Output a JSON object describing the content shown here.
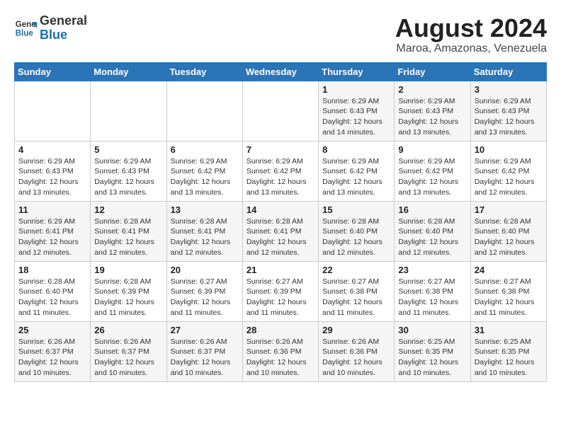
{
  "logo": {
    "general": "General",
    "blue": "Blue"
  },
  "title": "August 2024",
  "subtitle": "Maroa, Amazonas, Venezuela",
  "days_of_week": [
    "Sunday",
    "Monday",
    "Tuesday",
    "Wednesday",
    "Thursday",
    "Friday",
    "Saturday"
  ],
  "weeks": [
    [
      {
        "day": "",
        "info": ""
      },
      {
        "day": "",
        "info": ""
      },
      {
        "day": "",
        "info": ""
      },
      {
        "day": "",
        "info": ""
      },
      {
        "day": "1",
        "info": "Sunrise: 6:29 AM\nSunset: 6:43 PM\nDaylight: 12 hours\nand 14 minutes."
      },
      {
        "day": "2",
        "info": "Sunrise: 6:29 AM\nSunset: 6:43 PM\nDaylight: 12 hours\nand 13 minutes."
      },
      {
        "day": "3",
        "info": "Sunrise: 6:29 AM\nSunset: 6:43 PM\nDaylight: 12 hours\nand 13 minutes."
      }
    ],
    [
      {
        "day": "4",
        "info": "Sunrise: 6:29 AM\nSunset: 6:43 PM\nDaylight: 12 hours\nand 13 minutes."
      },
      {
        "day": "5",
        "info": "Sunrise: 6:29 AM\nSunset: 6:43 PM\nDaylight: 12 hours\nand 13 minutes."
      },
      {
        "day": "6",
        "info": "Sunrise: 6:29 AM\nSunset: 6:42 PM\nDaylight: 12 hours\nand 13 minutes."
      },
      {
        "day": "7",
        "info": "Sunrise: 6:29 AM\nSunset: 6:42 PM\nDaylight: 12 hours\nand 13 minutes."
      },
      {
        "day": "8",
        "info": "Sunrise: 6:29 AM\nSunset: 6:42 PM\nDaylight: 12 hours\nand 13 minutes."
      },
      {
        "day": "9",
        "info": "Sunrise: 6:29 AM\nSunset: 6:42 PM\nDaylight: 12 hours\nand 13 minutes."
      },
      {
        "day": "10",
        "info": "Sunrise: 6:29 AM\nSunset: 6:42 PM\nDaylight: 12 hours\nand 12 minutes."
      }
    ],
    [
      {
        "day": "11",
        "info": "Sunrise: 6:29 AM\nSunset: 6:41 PM\nDaylight: 12 hours\nand 12 minutes."
      },
      {
        "day": "12",
        "info": "Sunrise: 6:28 AM\nSunset: 6:41 PM\nDaylight: 12 hours\nand 12 minutes."
      },
      {
        "day": "13",
        "info": "Sunrise: 6:28 AM\nSunset: 6:41 PM\nDaylight: 12 hours\nand 12 minutes."
      },
      {
        "day": "14",
        "info": "Sunrise: 6:28 AM\nSunset: 6:41 PM\nDaylight: 12 hours\nand 12 minutes."
      },
      {
        "day": "15",
        "info": "Sunrise: 6:28 AM\nSunset: 6:40 PM\nDaylight: 12 hours\nand 12 minutes."
      },
      {
        "day": "16",
        "info": "Sunrise: 6:28 AM\nSunset: 6:40 PM\nDaylight: 12 hours\nand 12 minutes."
      },
      {
        "day": "17",
        "info": "Sunrise: 6:28 AM\nSunset: 6:40 PM\nDaylight: 12 hours\nand 12 minutes."
      }
    ],
    [
      {
        "day": "18",
        "info": "Sunrise: 6:28 AM\nSunset: 6:40 PM\nDaylight: 12 hours\nand 11 minutes."
      },
      {
        "day": "19",
        "info": "Sunrise: 6:28 AM\nSunset: 6:39 PM\nDaylight: 12 hours\nand 11 minutes."
      },
      {
        "day": "20",
        "info": "Sunrise: 6:27 AM\nSunset: 6:39 PM\nDaylight: 12 hours\nand 11 minutes."
      },
      {
        "day": "21",
        "info": "Sunrise: 6:27 AM\nSunset: 6:39 PM\nDaylight: 12 hours\nand 11 minutes."
      },
      {
        "day": "22",
        "info": "Sunrise: 6:27 AM\nSunset: 6:38 PM\nDaylight: 12 hours\nand 11 minutes."
      },
      {
        "day": "23",
        "info": "Sunrise: 6:27 AM\nSunset: 6:38 PM\nDaylight: 12 hours\nand 11 minutes."
      },
      {
        "day": "24",
        "info": "Sunrise: 6:27 AM\nSunset: 6:38 PM\nDaylight: 12 hours\nand 11 minutes."
      }
    ],
    [
      {
        "day": "25",
        "info": "Sunrise: 6:26 AM\nSunset: 6:37 PM\nDaylight: 12 hours\nand 10 minutes."
      },
      {
        "day": "26",
        "info": "Sunrise: 6:26 AM\nSunset: 6:37 PM\nDaylight: 12 hours\nand 10 minutes."
      },
      {
        "day": "27",
        "info": "Sunrise: 6:26 AM\nSunset: 6:37 PM\nDaylight: 12 hours\nand 10 minutes."
      },
      {
        "day": "28",
        "info": "Sunrise: 6:26 AM\nSunset: 6:36 PM\nDaylight: 12 hours\nand 10 minutes."
      },
      {
        "day": "29",
        "info": "Sunrise: 6:26 AM\nSunset: 6:36 PM\nDaylight: 12 hours\nand 10 minutes."
      },
      {
        "day": "30",
        "info": "Sunrise: 6:25 AM\nSunset: 6:35 PM\nDaylight: 12 hours\nand 10 minutes."
      },
      {
        "day": "31",
        "info": "Sunrise: 6:25 AM\nSunset: 6:35 PM\nDaylight: 12 hours\nand 10 minutes."
      }
    ]
  ]
}
